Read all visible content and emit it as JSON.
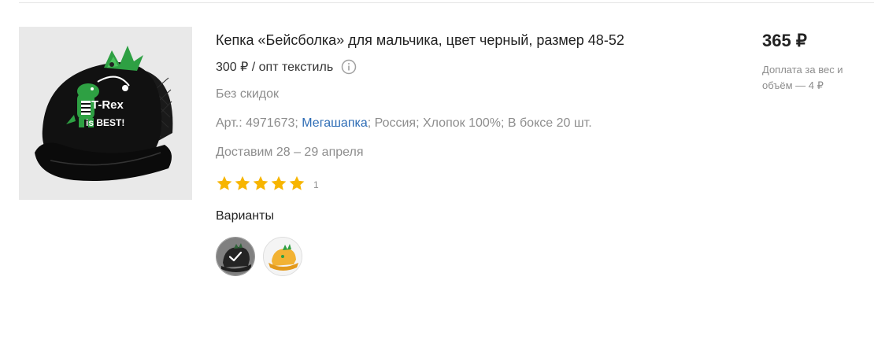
{
  "product": {
    "title": "Кепка «Бейсболка» для мальчика, цвет черный, размер 48-52",
    "wholesale_price": "300 ₽ / опт текстиль",
    "discount": "Без скидок",
    "meta_prefix": "Арт.: 4971673; ",
    "brand": "Мегашапка",
    "meta_suffix": "; Россия; Хлопок 100%; В боксе 20 шт.",
    "delivery": "Доставим 28 – 29 апреля",
    "rating": 5,
    "rating_count": "1",
    "image_text_line1": "T-Rex",
    "image_text_line2": "is BEST!"
  },
  "variants": {
    "label": "Варианты",
    "items": [
      {
        "name": "black",
        "color": "#1a1a1a",
        "selected": true
      },
      {
        "name": "yellow",
        "color": "#f2b233",
        "selected": false
      }
    ]
  },
  "price": {
    "value": "365 ₽",
    "extra": "Доплата за вес и объём — 4 ₽"
  },
  "colors": {
    "star": "#f7b500",
    "link": "#2d6cb5",
    "muted": "#8d8d8d",
    "dino_green": "#2ea043"
  },
  "icons": [
    "info-icon",
    "star-icon",
    "check-icon"
  ]
}
